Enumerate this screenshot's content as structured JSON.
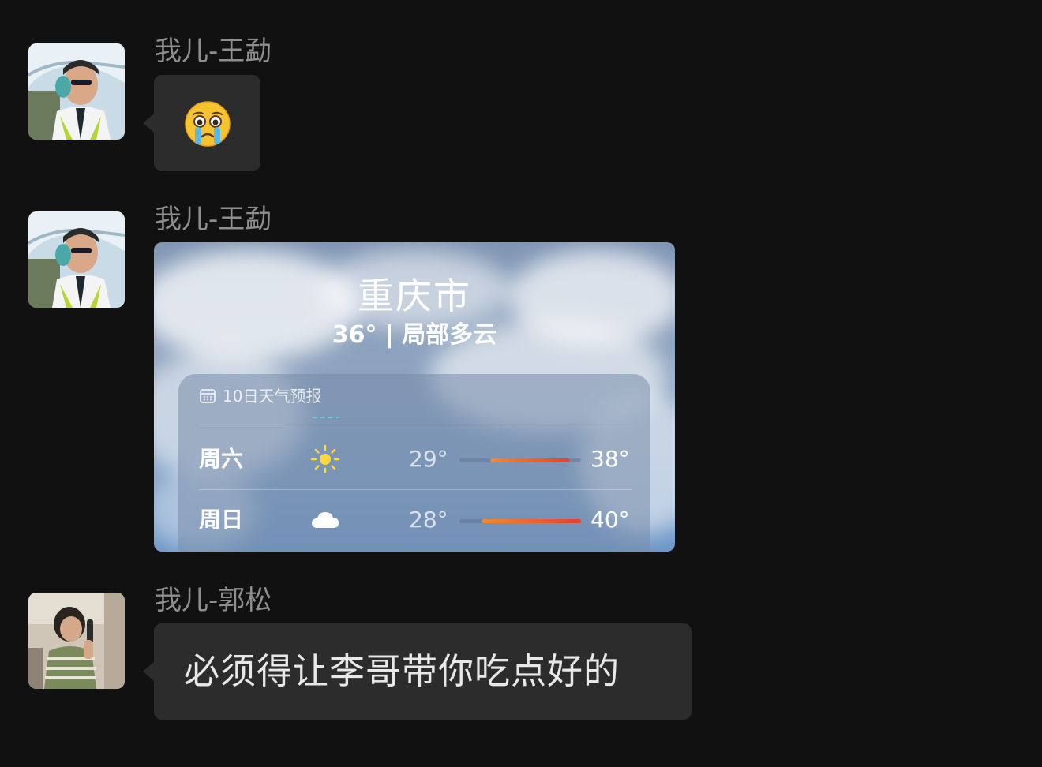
{
  "messages": [
    {
      "sender": "我儿-王勐",
      "type": "emoji",
      "emoji": "crying-face"
    },
    {
      "sender": "我儿-王勐",
      "type": "weather_card",
      "weather": {
        "city": "重庆市",
        "current": "36° | 局部多云",
        "forecast_title": "10日天气预报",
        "days": [
          {
            "day": "周六",
            "icon": "sun-icon",
            "low": "29°",
            "high": "38°",
            "range": [
              0.25,
              0.9
            ]
          },
          {
            "day": "周日",
            "icon": "cloud-icon",
            "low": "28°",
            "high": "40°",
            "range": [
              0.18,
              1.0
            ]
          }
        ]
      }
    },
    {
      "sender": "我儿-郭松",
      "type": "text",
      "text": "必须得让李哥带你吃点好的"
    }
  ],
  "colors": {
    "background": "#111111",
    "bubble": "#2c2c2c",
    "sender_name": "#8e8e8e",
    "temp_bar_start": "#f28a2e",
    "temp_bar_end": "#e8402c"
  }
}
